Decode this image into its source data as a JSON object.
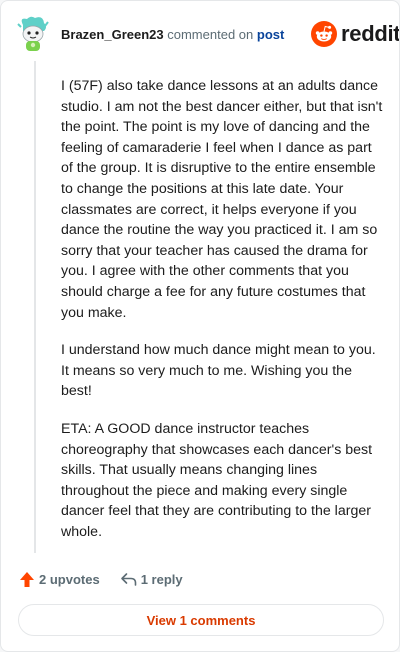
{
  "header": {
    "username": "Brazen_Green23",
    "action_text": "commented on",
    "post_link": "post"
  },
  "logo": {
    "wordmark": "reddit",
    "icon": "reddit-alien-icon",
    "color": "#ff4500"
  },
  "avatar": {
    "icon": "snoo-avatar-icon",
    "color": "#5fd0c8"
  },
  "comment": {
    "paragraphs": [
      "I (57F) also take dance lessons at an adults dance studio. I am not the best dancer either, but that isn't the point. The point is my love of dancing and the feeling of camaraderie I feel when I dance as part of the group. It is disruptive to the entire ensemble to change the positions at this late date. Your classmates are correct, it helps everyone if you dance the routine the way you practiced it. I am so sorry that your teacher has caused the drama for you. I agree with the other comments that you should charge a fee for any future costumes that you make.",
      "I understand how much dance might mean to you. It means so very much to me. Wishing you the best!",
      "ETA: A GOOD dance instructor teaches choreography that showcases each dancer's best skills. That usually means changing lines throughout the piece and making every single dancer feel that they are contributing to the larger whole."
    ]
  },
  "actions": {
    "upvotes": "2 upvotes",
    "upvote_icon": "upvote-arrow-icon",
    "upvote_color": "#ff4500",
    "replies": "1 reply",
    "reply_icon": "reply-arrow-icon"
  },
  "view_button": {
    "label": "View 1 comments",
    "color": "#d93a00"
  }
}
